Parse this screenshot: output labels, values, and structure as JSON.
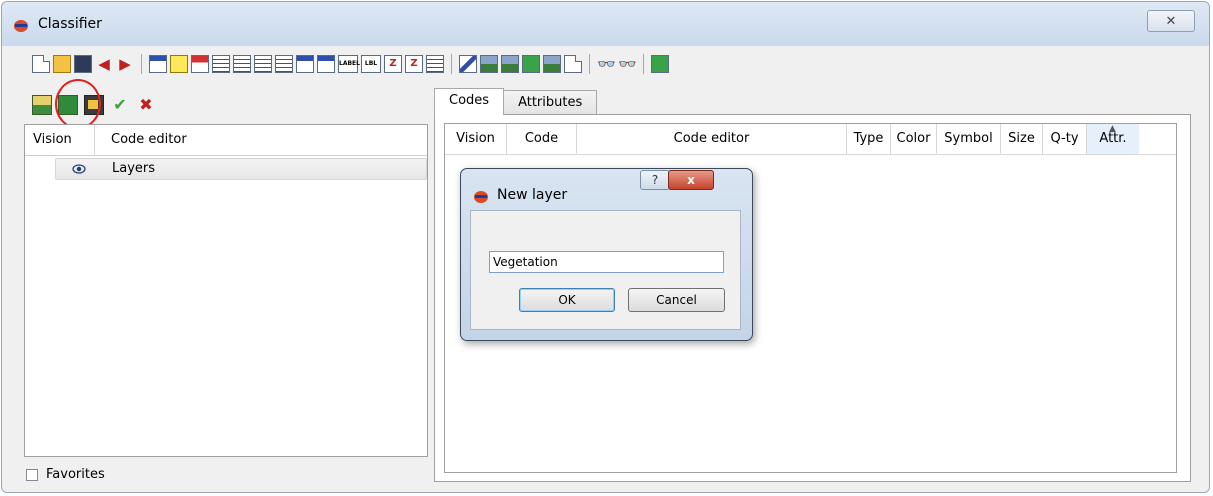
{
  "window": {
    "title": "Classifier",
    "close_label": "✕"
  },
  "left_panel": {
    "headers": {
      "vision": "Vision",
      "code_editor": "Code editor"
    },
    "rows": [
      {
        "label": "Layers"
      }
    ],
    "favorites_label": "Favorites"
  },
  "tabs": [
    {
      "label": "Codes",
      "active": true
    },
    {
      "label": "Attributes",
      "active": false
    }
  ],
  "codes_table": {
    "columns": [
      "Vision",
      "Code",
      "Code editor",
      "Type",
      "Color",
      "Symbol",
      "Size",
      "Q-ty",
      "Attr."
    ],
    "sorted_column": "Attr."
  },
  "dialog": {
    "title": "New layer",
    "help_label": "?",
    "close_label": "x",
    "input_value": "Vegetation",
    "ok_label": "OK",
    "cancel_label": "Cancel"
  },
  "highlight": {
    "target": "new-layer-button",
    "color": "#e02020"
  },
  "icons": {
    "app": "classifier-app-icon",
    "visibility": "eye-icon"
  }
}
